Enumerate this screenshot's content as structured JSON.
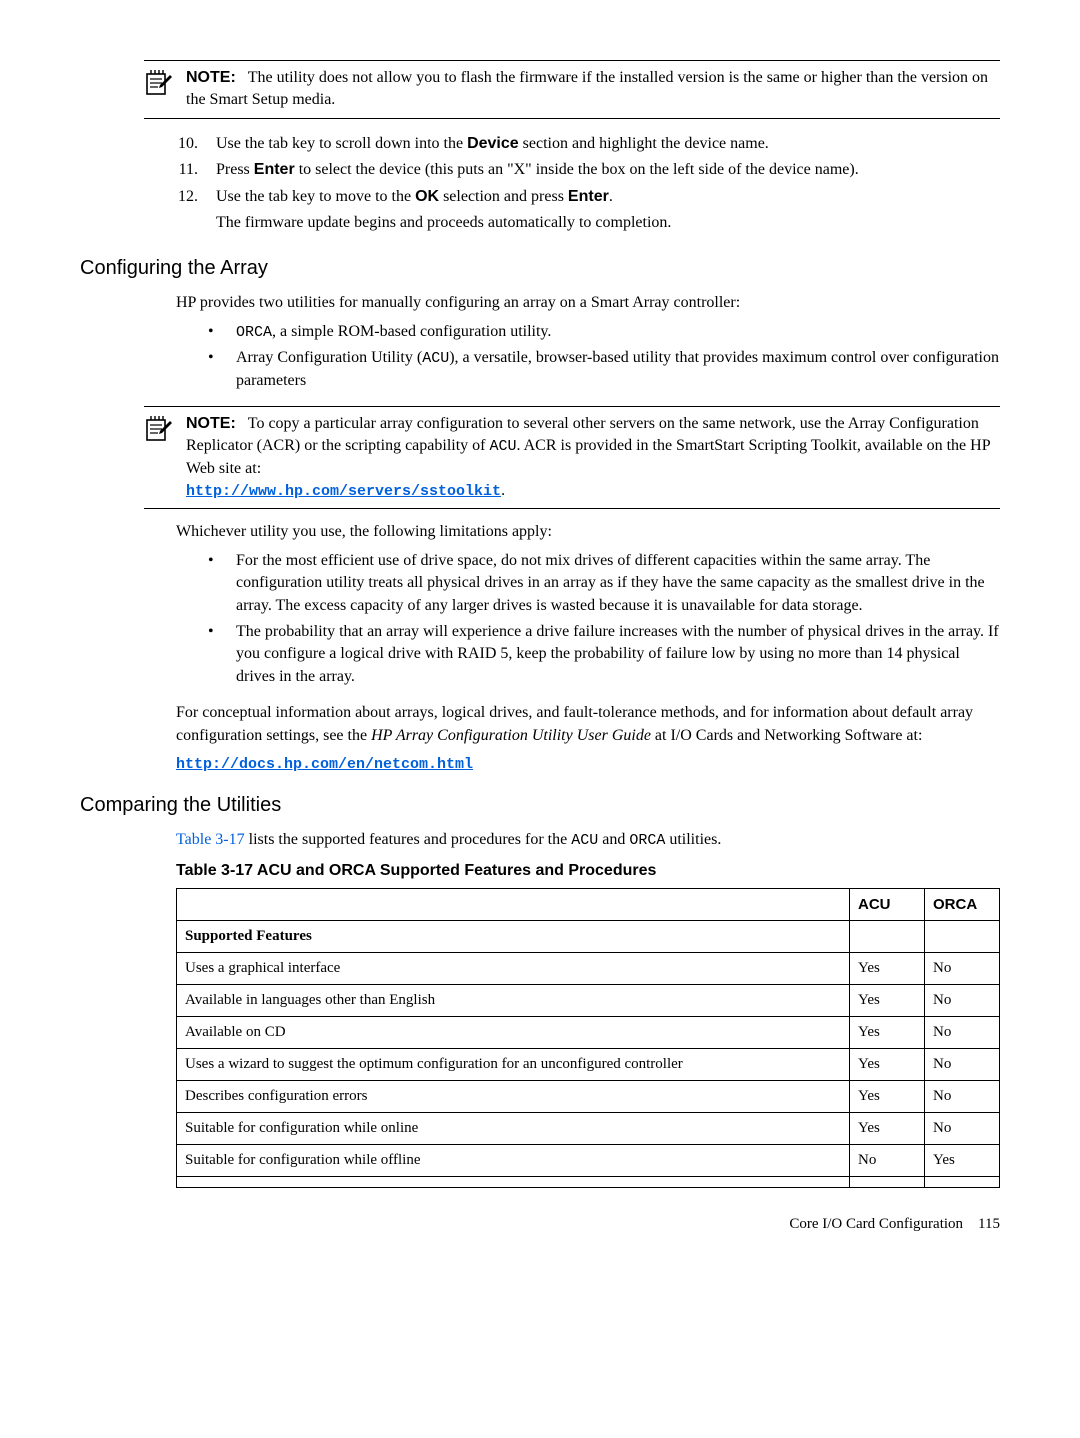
{
  "note1": {
    "label": "NOTE:",
    "text": "The utility does not allow you to flash the firmware if the installed version is the same or higher than the version on the Smart Setup media."
  },
  "steps": {
    "s10": {
      "n": "10.",
      "a": "Use the tab key to scroll down into the ",
      "b": "Device",
      "c": " section and highlight the device name."
    },
    "s11": {
      "n": "11.",
      "a": "Press ",
      "b": "Enter",
      "c": " to select the device (this puts an \"X\" inside the box on the left side of the device name)."
    },
    "s12": {
      "n": "12.",
      "a": "Use the tab key to move to the ",
      "b": "OK",
      "c": " selection and press ",
      "d": "Enter",
      "e": ".",
      "sub": "The firmware update begins and proceeds automatically to completion."
    }
  },
  "cfgArray": {
    "heading": "Configuring the Array",
    "intro": "HP provides two utilities for manually configuring an array on a Smart Array controller:",
    "b1a": "ORCA",
    "b1b": ", a simple ROM-based configuration utility.",
    "b2a": "Array Configuration Utility (",
    "b2b": "ACU",
    "b2c": "), a versatile, browser-based utility that provides maximum control over configuration parameters"
  },
  "note2": {
    "label": "NOTE:",
    "a": "To copy a particular array configuration to several other servers on the same network, use the Array Configuration Replicator (ACR) or the scripting capability of ",
    "b": "ACU",
    "c": ". ACR is provided in the SmartStart Scripting Toolkit, available on the HP Web site at:",
    "link": "http://www.hp.com/servers/sstoolkit",
    "dot": "."
  },
  "limits": {
    "intro": "Whichever utility you use, the following limitations apply:",
    "b1": "For the most efficient use of drive space, do not mix drives of different capacities within the same array. The configuration utility treats all physical drives in an array as if they have the same capacity as the smallest drive in the array. The excess capacity of any larger drives is wasted because it is unavailable for data storage.",
    "b2": "The probability that an array will experience a drive failure increases with the number of physical drives in the array. If you configure a logical drive with RAID 5, keep the probability of failure low by using no more than 14 physical drives in the array."
  },
  "concept": {
    "a": "For conceptual information about arrays, logical drives, and fault-tolerance methods, and for information about default array configuration settings, see the ",
    "b": "HP Array Configuration Utility User Guide",
    "c": " at I/O Cards and Networking Software at:",
    "link": "http://docs.hp.com/en/netcom.html"
  },
  "compare": {
    "heading": "Comparing the Utilities",
    "introA": "Table 3-17",
    "introB": " lists the supported features and procedures for the ",
    "introC": "ACU",
    "introD": " and ",
    "introE": "ORCA",
    "introF": " utilities.",
    "caption": "Table  3-17  ACU and ORCA Supported Features and Procedures"
  },
  "table": {
    "hAcu": "ACU",
    "hOrca": "ORCA",
    "rows": [
      {
        "f": "Supported Features",
        "a": "",
        "o": "",
        "header": true
      },
      {
        "f": "Uses a graphical interface",
        "a": "Yes",
        "o": "No"
      },
      {
        "f": "Available in languages other than English",
        "a": "Yes",
        "o": "No"
      },
      {
        "f": "Available on CD",
        "a": "Yes",
        "o": "No"
      },
      {
        "f": "Uses a wizard to suggest the optimum configuration for an unconfigured controller",
        "a": "Yes",
        "o": "No"
      },
      {
        "f": "Describes configuration errors",
        "a": "Yes",
        "o": "No"
      },
      {
        "f": "Suitable for configuration while online",
        "a": "Yes",
        "o": "No"
      },
      {
        "f": "Suitable for configuration while offline",
        "a": "No",
        "o": "Yes"
      },
      {
        "f": "",
        "a": "",
        "o": ""
      }
    ]
  },
  "footer": {
    "a": "Core I/O Card Configuration",
    "b": "115"
  }
}
